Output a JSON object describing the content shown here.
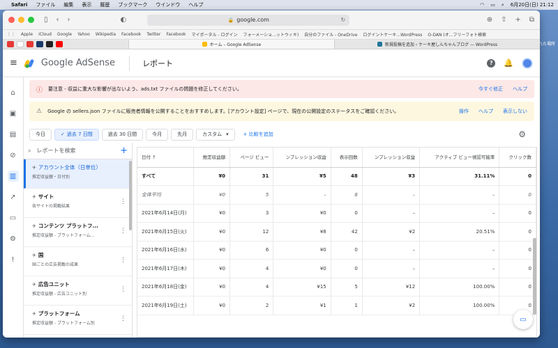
{
  "macos": {
    "menubar": [
      "Safari",
      "ファイル",
      "編集",
      "表示",
      "履歴",
      "ブックマーク",
      "ウインドウ",
      "ヘルプ"
    ],
    "datetime": "6月20日(日) 21:12",
    "desktop_label": "れた場所"
  },
  "browser": {
    "url": "google.com",
    "favorites": [
      "Apple",
      "iCloud",
      "Google",
      "Yahoo",
      "Wikipedia",
      "Facebook",
      "Twitter",
      "Facebook",
      "マイポータル - ログイン",
      "フォーメーショ...ットウィキ)",
      "自分のファイル - OneDrive",
      "ログイントケーキ...WordPress",
      "O-DAN (オ...フリーフォト検索"
    ],
    "tabs": [
      {
        "label": "ホーム – Google AdSense",
        "active": true
      },
      {
        "label": "新規投稿を追加 ‹ ケーキ屋しんちゃんブログ — WordPress",
        "active": false
      }
    ]
  },
  "app": {
    "brand": "Google AdSense",
    "page_title": "レポート"
  },
  "alerts": [
    {
      "type": "error",
      "text": "要注意 - 収益に重大な影響が出ないよう、ads.txt ファイルの問題を修正してください。",
      "actions": [
        "今すぐ修正",
        "ヘルプ"
      ]
    },
    {
      "type": "warning",
      "text": "Google の sellers.json ファイルに販売者情報を公開することをおすすめします。[アカウント設定] ページで、現在の公開設定のステータスをご確認ください。",
      "actions": [
        "操作",
        "ヘルプ",
        "表示しない"
      ]
    }
  ],
  "date_ranges": [
    "今日",
    "過去 7 日間",
    "過去 30 日間",
    "今月",
    "先月",
    "カスタム"
  ],
  "selected_range": "過去 7 日間",
  "compare_label": "比較を追加",
  "search_placeholder": "レポートを検索",
  "reports": [
    {
      "title": "アカウント全体（日単位）",
      "subtitle": "推定収益額・日付別",
      "active": true
    },
    {
      "title": "サイト",
      "subtitle": "各サイトの掲載結果",
      "active": false
    },
    {
      "title": "コンテンツ プラットフ...",
      "subtitle": "推定収益額 - プラットフォーム...",
      "active": false
    },
    {
      "title": "国",
      "subtitle": "国ごとの広告掲載の成果",
      "active": false
    },
    {
      "title": "広告ユニット",
      "subtitle": "推定収益額 - 広告ユニット別",
      "active": false
    },
    {
      "title": "プラットフォーム",
      "subtitle": "推定収益額 - プラットフォーム別",
      "active": false
    }
  ],
  "table": {
    "headers": [
      "日付 ↑",
      "推定収益額",
      "ページ ビュー",
      "ンプレッション収益",
      "表示回数",
      "ンプレッション収益",
      "アクティブ ビュー視認可能率",
      "クリック数"
    ],
    "rows": [
      {
        "kind": "total",
        "cells": [
          "すべて",
          "¥0",
          "31",
          "¥5",
          "48",
          "¥3",
          "31.11%",
          "0"
        ]
      },
      {
        "kind": "avg",
        "cells": [
          "全体平均",
          "¥0",
          "5",
          "–",
          "8",
          "–",
          "–",
          "0"
        ]
      },
      {
        "kind": "row",
        "cells": [
          "2021年6月14日(月)",
          "¥0",
          "3",
          "¥0",
          "0",
          "–",
          "–",
          "0"
        ]
      },
      {
        "kind": "row",
        "cells": [
          "2021年6月15日(火)",
          "¥0",
          "12",
          "¥8",
          "42",
          "¥2",
          "20.51%",
          "0"
        ]
      },
      {
        "kind": "row",
        "cells": [
          "2021年6月16日(水)",
          "¥0",
          "6",
          "¥0",
          "0",
          "–",
          "–",
          "0"
        ]
      },
      {
        "kind": "row",
        "cells": [
          "2021年6月17日(木)",
          "¥0",
          "4",
          "¥0",
          "0",
          "–",
          "–",
          "0"
        ]
      },
      {
        "kind": "row",
        "cells": [
          "2021年6月18日(金)",
          "¥0",
          "4",
          "¥15",
          "5",
          "¥12",
          "100.00%",
          "0"
        ]
      },
      {
        "kind": "row",
        "cells": [
          "2021年6月19日(土)",
          "¥0",
          "2",
          "¥1",
          "1",
          "¥2",
          "100.00%",
          "0"
        ]
      }
    ]
  }
}
